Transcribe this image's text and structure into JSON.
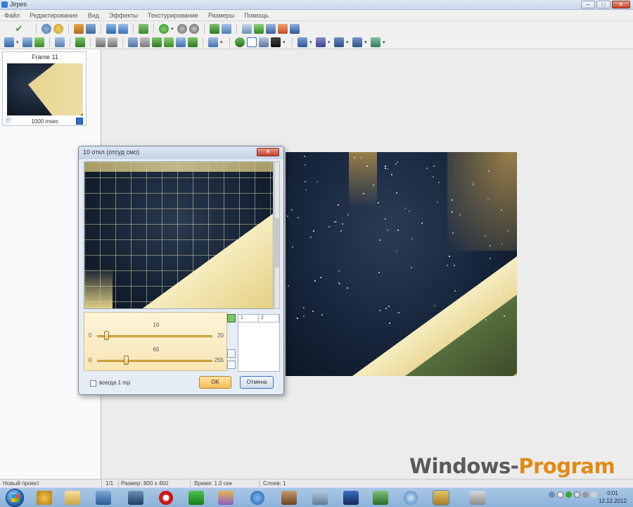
{
  "window": {
    "title": "Jirpes",
    "buttons": {
      "minimize": "–",
      "maximize": "□",
      "close": "✕"
    }
  },
  "menu": {
    "items": [
      "Файл",
      "Редактирование",
      "Вид",
      "Эффекты",
      "Текстурирование",
      "Размеры",
      "Помощь"
    ]
  },
  "toolbar": {
    "row1_icons": [
      "apply-check-icon",
      "open-icon",
      "undo-icon",
      "copy-icon",
      "paste-icon",
      "frame-icon",
      "stack-icon",
      "play-icon",
      "record-icon",
      "stop-icon",
      "align-icon",
      "zoom-icon",
      "brush-icon",
      "image-icon",
      "grid-icon"
    ],
    "row2_icons": [
      "cursor-icon",
      "save-icon",
      "export-icon",
      "arrow-icon",
      "crop-icon",
      "rotate-icon",
      "flip-icon",
      "layer-icon",
      "layout-icon",
      "shape-icon",
      "rect-icon",
      "color-icon",
      "bucket-icon",
      "panel1-icon",
      "panel2-icon",
      "panel3-icon",
      "panel4-icon",
      "effect-icon"
    ]
  },
  "frames": {
    "items": [
      {
        "label": "Frame 11",
        "duration": "1000 msec"
      }
    ]
  },
  "dialog": {
    "title": "10 откл (отсуд смо)",
    "close_label": "✕",
    "slider1": {
      "value": "10",
      "min": "0",
      "max": "20",
      "position": 0.08
    },
    "slider2": {
      "value": "65",
      "min": "0",
      "max": "255",
      "position": 0.25
    },
    "preset_tabs": [
      "1",
      "2"
    ],
    "checkbox_label": "всегда 1 mp",
    "ok_label": "OK",
    "cancel_label": "Отмена"
  },
  "status": {
    "project": "Новый проект",
    "frames": "1/1",
    "size": "Размер: 800 x 450",
    "time": "Время: 1.0 сек",
    "layers": "Слоев: 1"
  },
  "watermark": {
    "part1": "Windows-",
    "part2": "Program"
  },
  "taskbar": {
    "clock_time": "0:01",
    "clock_date": "12.12.2012"
  },
  "colors": {
    "accent": "#e18a14",
    "titlebar": "#c9d9ec",
    "dialog_ok": "#f6bd55",
    "taskbar": "#8cb2d9"
  }
}
